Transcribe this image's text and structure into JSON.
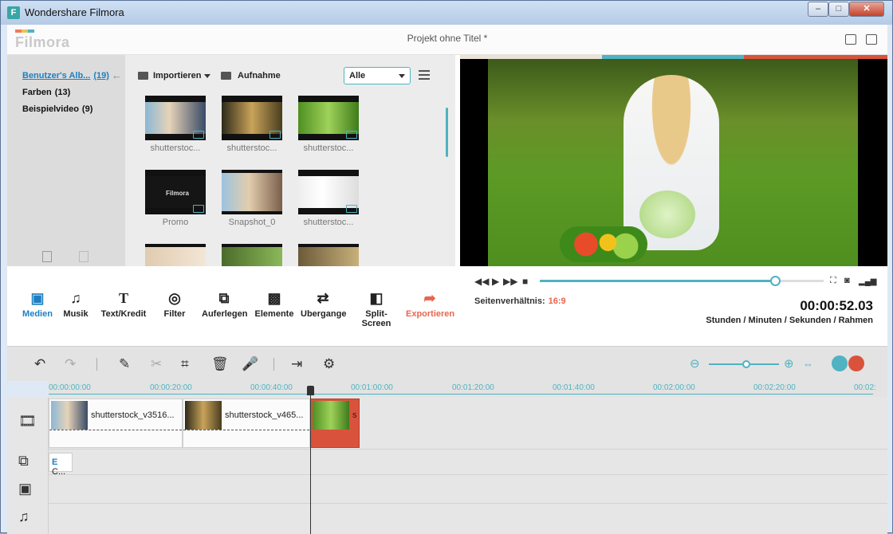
{
  "window": {
    "title": "Wondershare Filmora",
    "app_icon": "F",
    "min": "–",
    "max": "□",
    "close": "✕"
  },
  "header": {
    "logo": "Filmora",
    "project_title": "Projekt ohne Titel *"
  },
  "sidebar": {
    "items": [
      {
        "label": "Benutzer's Alb...",
        "count": "(19)"
      },
      {
        "label": "Farben",
        "count": "(13)"
      },
      {
        "label": "Beispielvideo",
        "count": "(9)"
      }
    ]
  },
  "library": {
    "import_label": "Importieren",
    "record_label": "Aufnahme",
    "filter_value": "Alle",
    "thumbnails": [
      {
        "label": "shutterstoc..."
      },
      {
        "label": "shutterstoc..."
      },
      {
        "label": "shutterstoc..."
      },
      {
        "label": "Promo",
        "logo": "Filmora"
      },
      {
        "label": "Snapshot_0"
      },
      {
        "label": "shutterstoc..."
      }
    ]
  },
  "tools": [
    {
      "label": "Medien"
    },
    {
      "label": "Musik"
    },
    {
      "label": "Text/Kredit"
    },
    {
      "label": "Filter"
    },
    {
      "label": "Auferlegen"
    },
    {
      "label": "Elemente"
    },
    {
      "label": "Ubergange"
    },
    {
      "label": "Split-Screen"
    },
    {
      "label": "Exportieren"
    }
  ],
  "player": {
    "aspect_label": "Seitenverhältnis:",
    "aspect_value": "16:9",
    "timecode": "00:00:52.03",
    "timecode_units": "Stunden / Minuten / Sekunden / Rahmen",
    "progress": 0.83
  },
  "timeline": {
    "ruler": [
      "00:00:00:00",
      "00:00:20:00",
      "00:00:40:00",
      "00:01:00:00",
      "00:01:20:00",
      "00:01:40:00",
      "00:02:00:00",
      "00:02:20:00",
      "00:02:"
    ],
    "clips": [
      {
        "name": "shutterstock_v3516..."
      },
      {
        "name": "shutterstock_v465..."
      },
      {
        "name": "s"
      }
    ],
    "text_clip": {
      "letter": "E",
      "label": "C..."
    }
  },
  "colors": {
    "accent": "#4fb3c1",
    "export": "#e8664d",
    "active": "#1d7fc0",
    "selected_clip": "#d9533c"
  }
}
